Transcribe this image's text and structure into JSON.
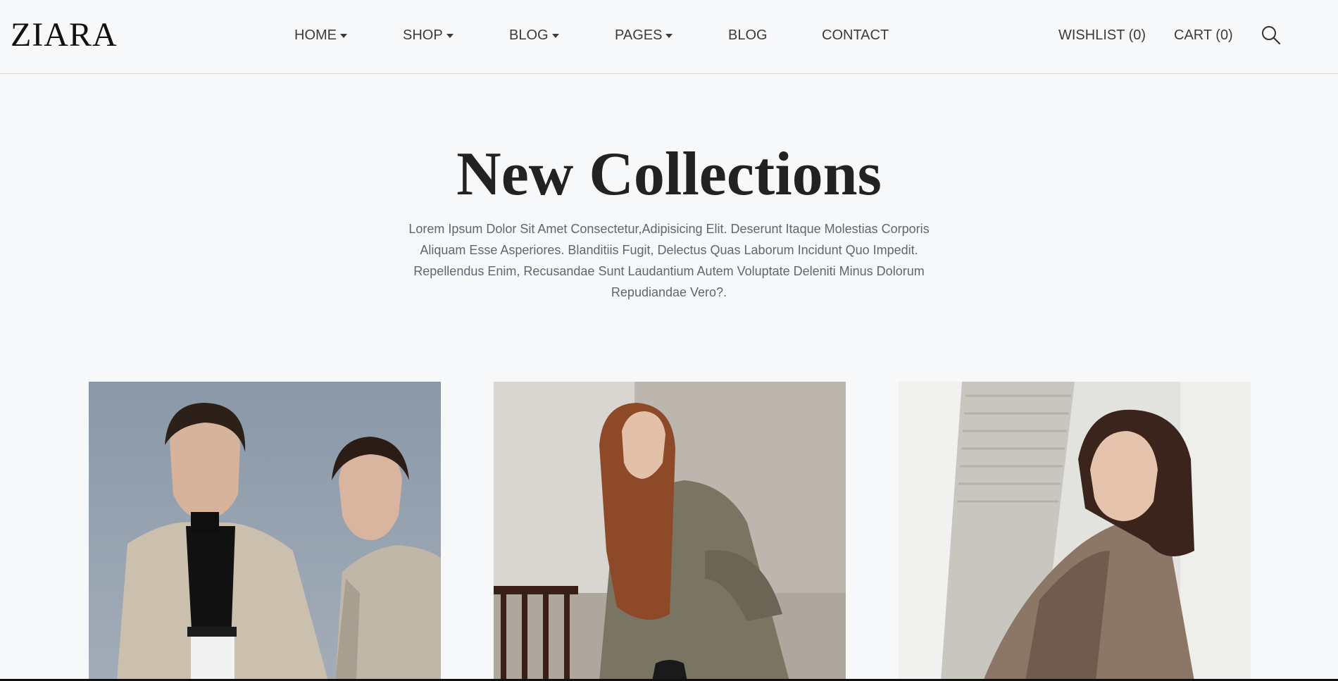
{
  "brand": {
    "logo": "ZIARA"
  },
  "nav": {
    "home": "HOME",
    "shop": "SHOP",
    "blog_menu": "BLOG",
    "pages": "PAGES",
    "blog": "BLOG",
    "contact": "CONTACT",
    "wishlist": "WISHLIST (0)",
    "cart": "CART (0)",
    "search_icon": "search-icon"
  },
  "hero": {
    "title": "New Collections",
    "description": "Lorem Ipsum Dolor Sit Amet Consectetur,Adipisicing Elit. Deserunt Itaque Molestias Corporis Aliquam Esse Asperiores. Blanditiis Fugit, Delectus Quas Laborum Incidunt Quo Impedit. Repellendus Enim, Recusandae Sunt Laudantium Autem Voluptate Deleniti Minus Dolorum Repudiandae Vero?."
  },
  "products": [
    {
      "image": "two-models-beige-trench-coats"
    },
    {
      "image": "model-long-red-hair-olive-dress-chair"
    },
    {
      "image": "model-plaid-blazer-leaning-wall"
    }
  ],
  "colors": {
    "background": "#f7f8fa",
    "text": "#333333",
    "title": "#222222",
    "muted": "#5f6670",
    "border": "#d6d6d6"
  }
}
